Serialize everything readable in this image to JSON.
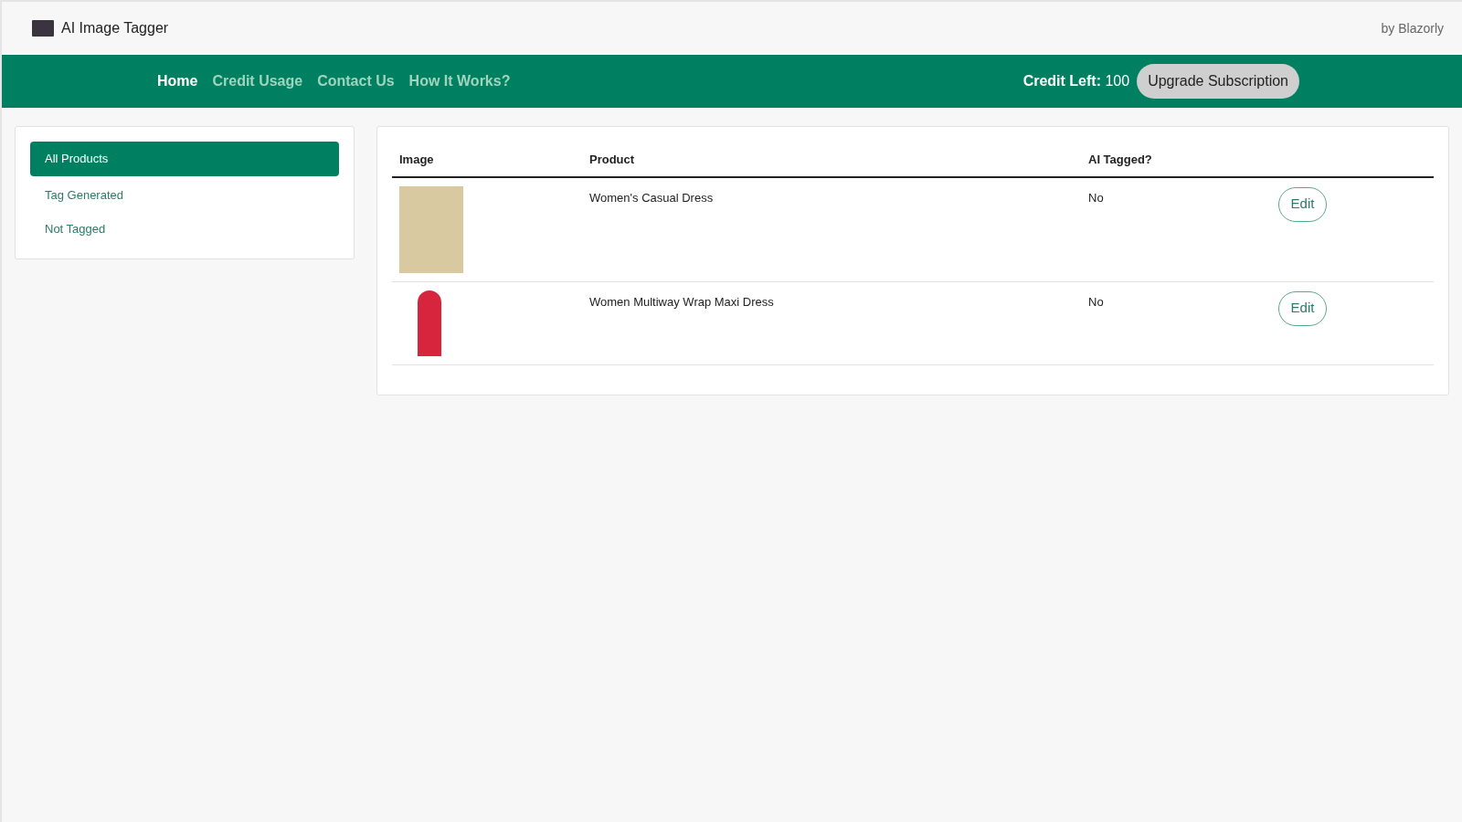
{
  "header": {
    "app_title": "AI Image Tagger",
    "byline": "by Blazorly"
  },
  "nav": {
    "links": [
      {
        "label": "Home",
        "selected": true
      },
      {
        "label": "Credit Usage",
        "selected": false
      },
      {
        "label": "Contact Us",
        "selected": false
      },
      {
        "label": "How It Works?",
        "selected": false
      }
    ],
    "credit_label": "Credit Left:",
    "credit_value": "100",
    "upgrade_button": "Upgrade Subscription"
  },
  "sidebar": {
    "items": [
      {
        "label": "All Products",
        "selected": true
      },
      {
        "label": "Tag Generated",
        "selected": false
      },
      {
        "label": "Not Tagged",
        "selected": false
      }
    ]
  },
  "table": {
    "columns": [
      "Image",
      "Product",
      "AI Tagged?"
    ],
    "rows": [
      {
        "product": "Women's Casual Dress",
        "ai_tagged": "No",
        "action": "Edit"
      },
      {
        "product": "Women Multiway Wrap Maxi Dress",
        "ai_tagged": "No",
        "action": "Edit"
      }
    ]
  }
}
